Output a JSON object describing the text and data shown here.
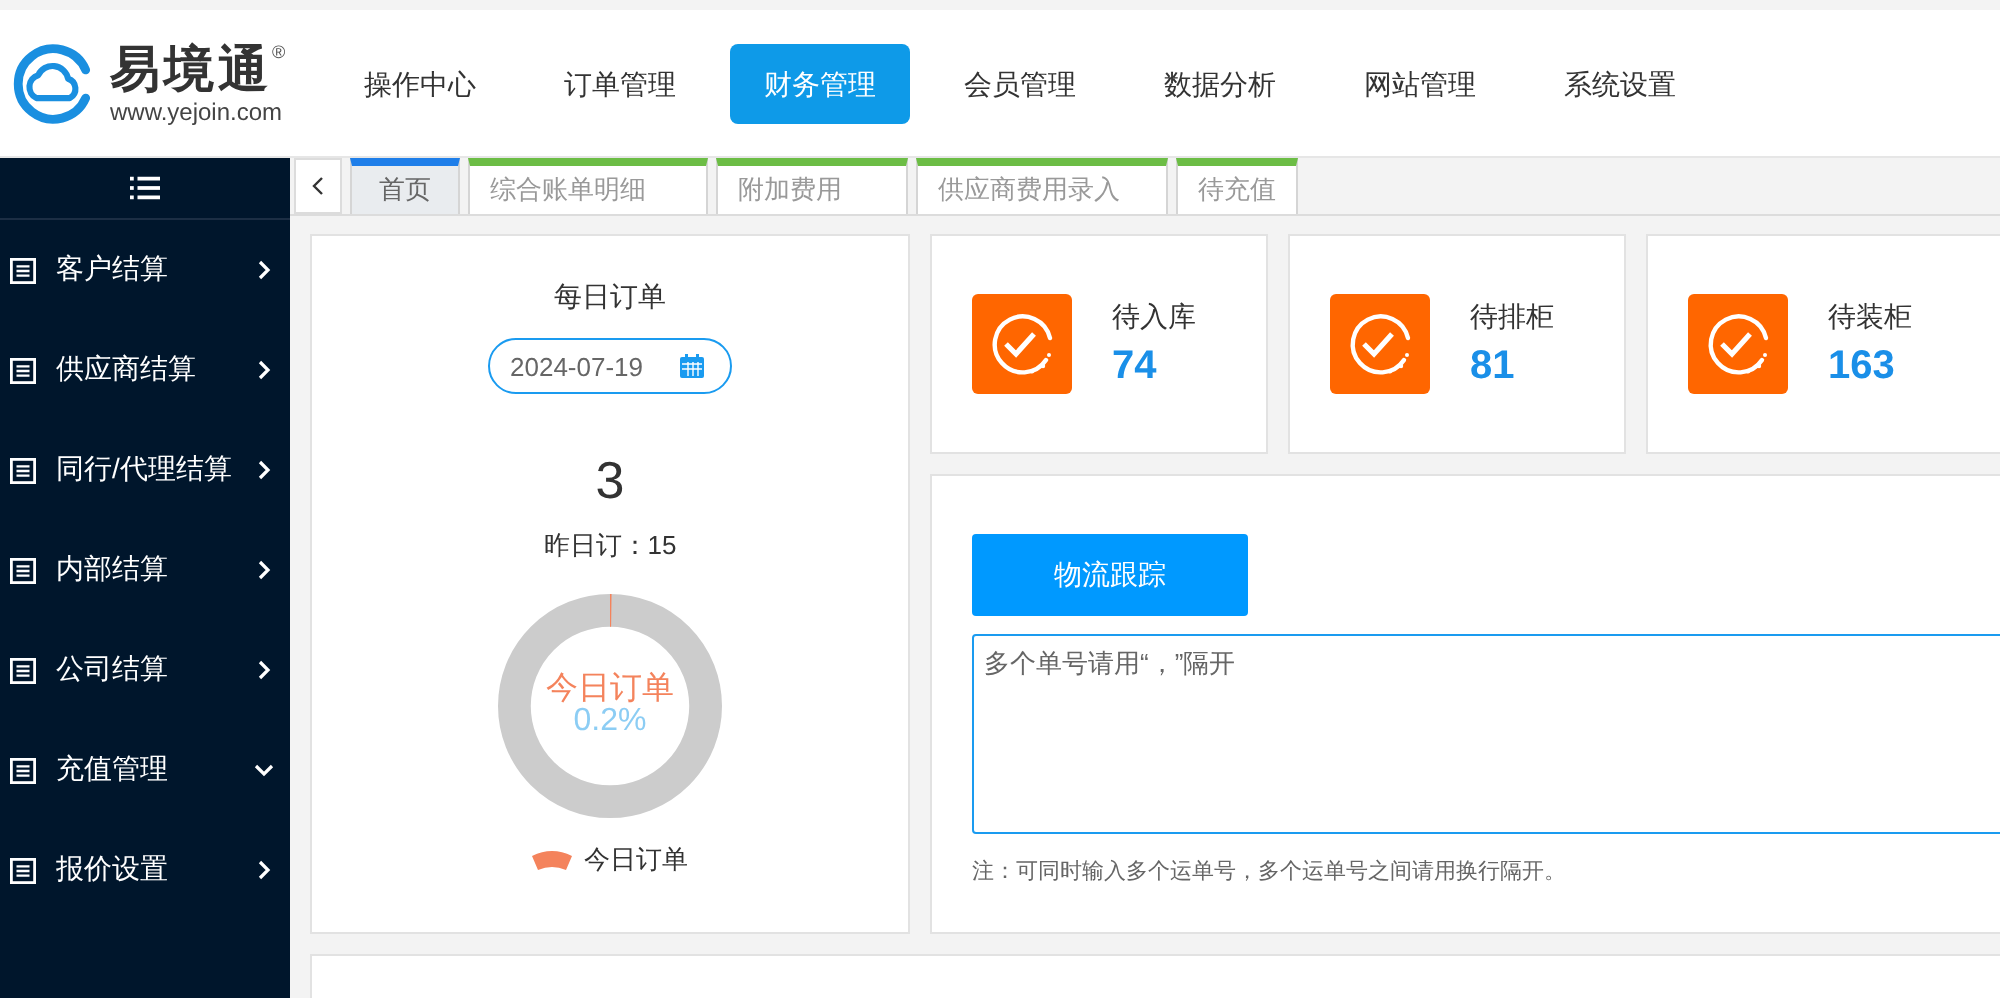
{
  "logo": {
    "name": "易境通",
    "mark": "®",
    "url": "www.yejoin.com"
  },
  "nav": [
    {
      "label": "操作中心",
      "selected": false
    },
    {
      "label": "订单管理",
      "selected": false
    },
    {
      "label": "财务管理",
      "selected": true
    },
    {
      "label": "会员管理",
      "selected": false
    },
    {
      "label": "数据分析",
      "selected": false
    },
    {
      "label": "网站管理",
      "selected": false
    },
    {
      "label": "系统设置",
      "selected": false
    }
  ],
  "sidebar": {
    "items": [
      {
        "label": "客户结算",
        "expanded": false
      },
      {
        "label": "供应商结算",
        "expanded": false
      },
      {
        "label": "同行/代理结算",
        "expanded": false
      },
      {
        "label": "内部结算",
        "expanded": false
      },
      {
        "label": "公司结算",
        "expanded": false
      },
      {
        "label": "充值管理",
        "expanded": true
      },
      {
        "label": "报价设置",
        "expanded": false
      }
    ]
  },
  "tabs": [
    {
      "label": "首页",
      "selected": true
    },
    {
      "label": "综合账单明细",
      "selected": false
    },
    {
      "label": "附加费用",
      "selected": false
    },
    {
      "label": "供应商费用录入",
      "selected": false
    },
    {
      "label": "待充值",
      "selected": false
    }
  ],
  "daily": {
    "title": "每日订单",
    "date": "2024-07-19",
    "count": "3",
    "yesterday": "昨日订：15",
    "gauge": {
      "label": "今日订单",
      "percent": "0.2%",
      "level": 0.002
    },
    "legend": "今日订单"
  },
  "stats": [
    {
      "label": "待入库",
      "value": "74"
    },
    {
      "label": "待排柜",
      "value": "81"
    },
    {
      "label": "待装柜",
      "value": "163"
    }
  ],
  "tracking": {
    "button": "物流跟踪",
    "placeholder": "多个单号请用“，”隔开",
    "note": "注：可同时输入多个运单号，多个运单号之间请用换行隔开。"
  }
}
